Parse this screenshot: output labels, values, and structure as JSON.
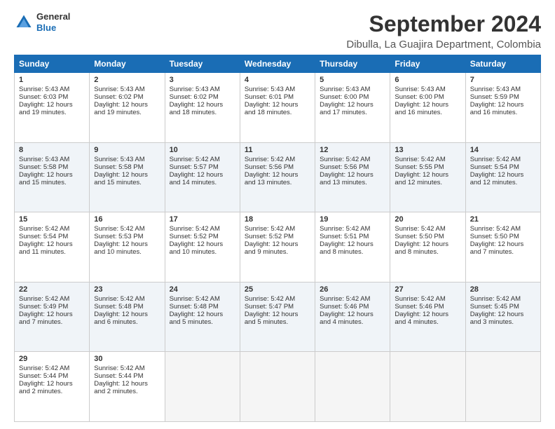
{
  "logo": {
    "general": "General",
    "blue": "Blue"
  },
  "header": {
    "month": "September 2024",
    "location": "Dibulla, La Guajira Department, Colombia"
  },
  "weekdays": [
    "Sunday",
    "Monday",
    "Tuesday",
    "Wednesday",
    "Thursday",
    "Friday",
    "Saturday"
  ],
  "weeks": [
    [
      {
        "day": "1",
        "sunrise": "5:43 AM",
        "sunset": "6:03 PM",
        "daylight": "12 hours and 19 minutes."
      },
      {
        "day": "2",
        "sunrise": "5:43 AM",
        "sunset": "6:02 PM",
        "daylight": "12 hours and 19 minutes."
      },
      {
        "day": "3",
        "sunrise": "5:43 AM",
        "sunset": "6:02 PM",
        "daylight": "12 hours and 18 minutes."
      },
      {
        "day": "4",
        "sunrise": "5:43 AM",
        "sunset": "6:01 PM",
        "daylight": "12 hours and 18 minutes."
      },
      {
        "day": "5",
        "sunrise": "5:43 AM",
        "sunset": "6:00 PM",
        "daylight": "12 hours and 17 minutes."
      },
      {
        "day": "6",
        "sunrise": "5:43 AM",
        "sunset": "6:00 PM",
        "daylight": "12 hours and 16 minutes."
      },
      {
        "day": "7",
        "sunrise": "5:43 AM",
        "sunset": "5:59 PM",
        "daylight": "12 hours and 16 minutes."
      }
    ],
    [
      {
        "day": "8",
        "sunrise": "5:43 AM",
        "sunset": "5:58 PM",
        "daylight": "12 hours and 15 minutes."
      },
      {
        "day": "9",
        "sunrise": "5:43 AM",
        "sunset": "5:58 PM",
        "daylight": "12 hours and 15 minutes."
      },
      {
        "day": "10",
        "sunrise": "5:42 AM",
        "sunset": "5:57 PM",
        "daylight": "12 hours and 14 minutes."
      },
      {
        "day": "11",
        "sunrise": "5:42 AM",
        "sunset": "5:56 PM",
        "daylight": "12 hours and 13 minutes."
      },
      {
        "day": "12",
        "sunrise": "5:42 AM",
        "sunset": "5:56 PM",
        "daylight": "12 hours and 13 minutes."
      },
      {
        "day": "13",
        "sunrise": "5:42 AM",
        "sunset": "5:55 PM",
        "daylight": "12 hours and 12 minutes."
      },
      {
        "day": "14",
        "sunrise": "5:42 AM",
        "sunset": "5:54 PM",
        "daylight": "12 hours and 12 minutes."
      }
    ],
    [
      {
        "day": "15",
        "sunrise": "5:42 AM",
        "sunset": "5:54 PM",
        "daylight": "12 hours and 11 minutes."
      },
      {
        "day": "16",
        "sunrise": "5:42 AM",
        "sunset": "5:53 PM",
        "daylight": "12 hours and 10 minutes."
      },
      {
        "day": "17",
        "sunrise": "5:42 AM",
        "sunset": "5:52 PM",
        "daylight": "12 hours and 10 minutes."
      },
      {
        "day": "18",
        "sunrise": "5:42 AM",
        "sunset": "5:52 PM",
        "daylight": "12 hours and 9 minutes."
      },
      {
        "day": "19",
        "sunrise": "5:42 AM",
        "sunset": "5:51 PM",
        "daylight": "12 hours and 8 minutes."
      },
      {
        "day": "20",
        "sunrise": "5:42 AM",
        "sunset": "5:50 PM",
        "daylight": "12 hours and 8 minutes."
      },
      {
        "day": "21",
        "sunrise": "5:42 AM",
        "sunset": "5:50 PM",
        "daylight": "12 hours and 7 minutes."
      }
    ],
    [
      {
        "day": "22",
        "sunrise": "5:42 AM",
        "sunset": "5:49 PM",
        "daylight": "12 hours and 7 minutes."
      },
      {
        "day": "23",
        "sunrise": "5:42 AM",
        "sunset": "5:48 PM",
        "daylight": "12 hours and 6 minutes."
      },
      {
        "day": "24",
        "sunrise": "5:42 AM",
        "sunset": "5:48 PM",
        "daylight": "12 hours and 5 minutes."
      },
      {
        "day": "25",
        "sunrise": "5:42 AM",
        "sunset": "5:47 PM",
        "daylight": "12 hours and 5 minutes."
      },
      {
        "day": "26",
        "sunrise": "5:42 AM",
        "sunset": "5:46 PM",
        "daylight": "12 hours and 4 minutes."
      },
      {
        "day": "27",
        "sunrise": "5:42 AM",
        "sunset": "5:46 PM",
        "daylight": "12 hours and 4 minutes."
      },
      {
        "day": "28",
        "sunrise": "5:42 AM",
        "sunset": "5:45 PM",
        "daylight": "12 hours and 3 minutes."
      }
    ],
    [
      {
        "day": "29",
        "sunrise": "5:42 AM",
        "sunset": "5:44 PM",
        "daylight": "12 hours and 2 minutes."
      },
      {
        "day": "30",
        "sunrise": "5:42 AM",
        "sunset": "5:44 PM",
        "daylight": "12 hours and 2 minutes."
      },
      null,
      null,
      null,
      null,
      null
    ]
  ],
  "labels": {
    "sunrise": "Sunrise:",
    "sunset": "Sunset:",
    "daylight": "Daylight:"
  }
}
